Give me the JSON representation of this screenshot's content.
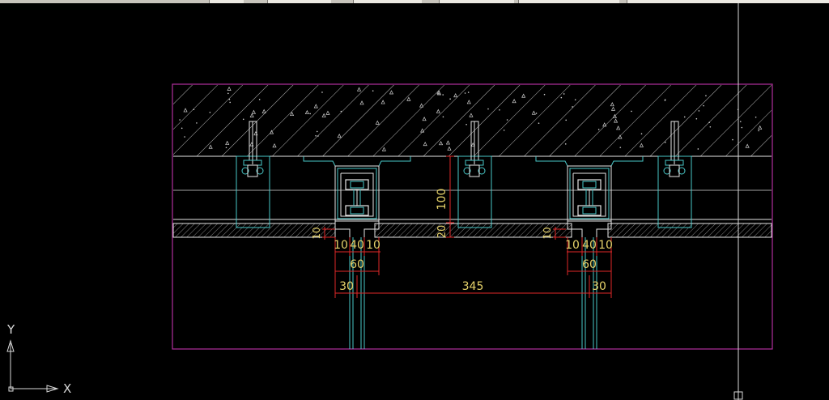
{
  "colors": {
    "background": "#000000",
    "frame": "#b0309c",
    "outline": "#e6e6e6",
    "profile": "#49c9c9",
    "dimension": "#e02828",
    "dim_text": "#e6d26a",
    "crosshair": "#d8d8d8"
  },
  "dimensions": {
    "height_100": "100",
    "height_20": "20",
    "left_gap_10": "10",
    "right_gap_10": "10",
    "left_split": [
      "10",
      "40",
      "10"
    ],
    "right_split": [
      "10",
      "40",
      "10"
    ],
    "left_60": "60",
    "right_60": "60",
    "left_30": "30",
    "right_30": "30",
    "span_345": "345"
  },
  "ucs": {
    "y_label": "Y",
    "x_label": "X"
  },
  "icons": {
    "ucs": "ucs-icon",
    "crosshair": "crosshair-cursor-icon",
    "pickbox": "pickbox-icon"
  }
}
